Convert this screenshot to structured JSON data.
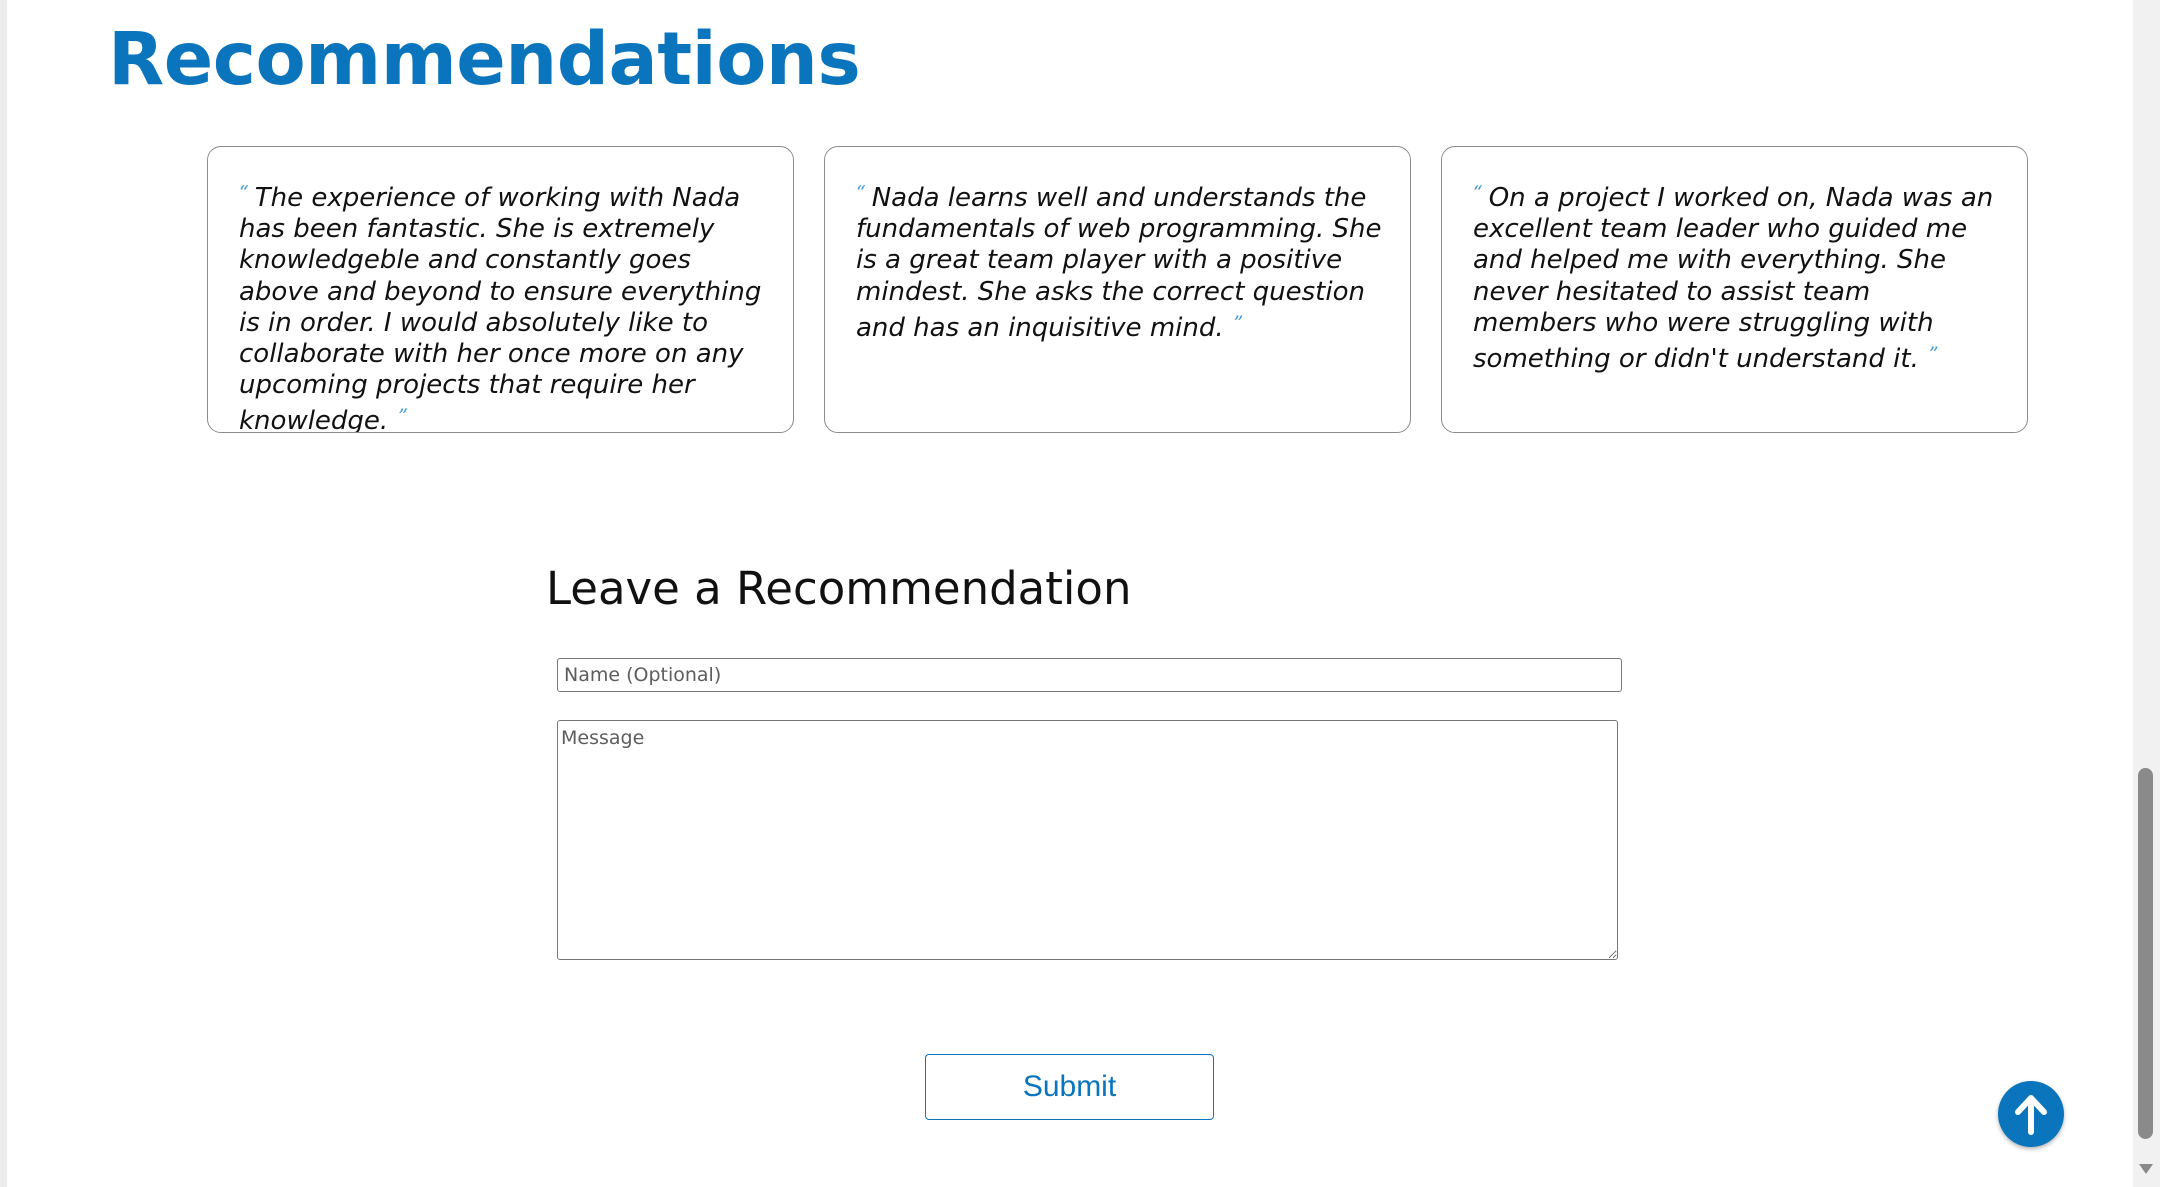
{
  "section": {
    "title": "Recommendations"
  },
  "recommendations": [
    {
      "open_quote": "“",
      "text": "The experience of working with Nada has been fantastic. She is extremely knowledgeble and constantly goes above and beyond to ensure everything is in order. I would absolutely like to collaborate with her once more on any upcoming projects that require her knowledge.",
      "close_quote": "”"
    },
    {
      "open_quote": "“",
      "text": "Nada learns well and understands the fundamentals of web programming. She is a great team player with a positive mindest. She asks the correct question and has an inquisitive mind.",
      "close_quote": "”"
    },
    {
      "open_quote": "“",
      "text": "On a project I worked on, Nada was an excellent team leader who guided me and helped me with everything. She never hesitated to assist team members who were struggling with something or didn't understand it.",
      "close_quote": "”"
    }
  ],
  "form": {
    "title": "Leave a Recommendation",
    "name_placeholder": "Name (Optional)",
    "name_value": "",
    "message_placeholder": "Message",
    "message_value": "",
    "submit_label": "Submit"
  },
  "scroll_top": {
    "icon": "arrow-up-icon"
  },
  "colors": {
    "accent": "#0a74bd",
    "quote_mark": "#3d9bd8",
    "card_border": "#8c8c8c"
  }
}
